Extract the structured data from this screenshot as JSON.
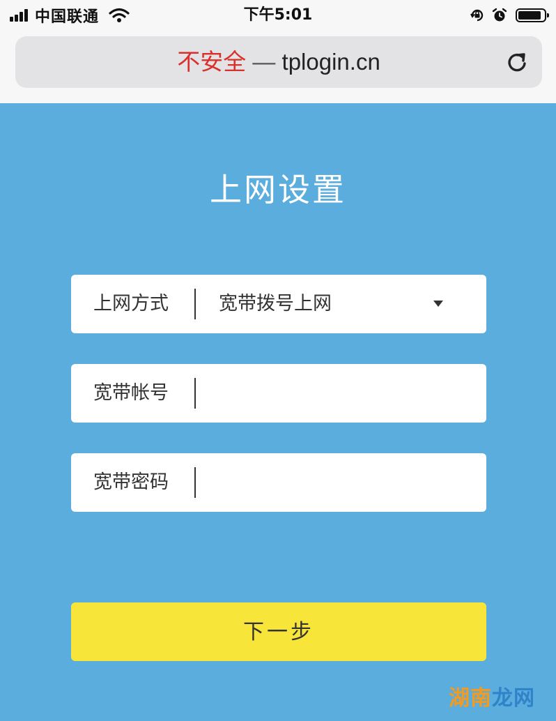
{
  "status_bar": {
    "carrier": "中国联通",
    "time": "下午5:01",
    "signal_bars": 4,
    "battery_level": 0.9,
    "icons": [
      "signal-icon",
      "wifi-icon",
      "orientation-lock-icon",
      "alarm-icon",
      "battery-icon"
    ]
  },
  "browser": {
    "security_warning": "不安全",
    "separator": "—",
    "domain": "tplogin.cn",
    "reload_icon": "reload-icon"
  },
  "page": {
    "title": "上网设置",
    "fields": [
      {
        "label": "上网方式",
        "value": "宽带拨号上网",
        "type": "select"
      },
      {
        "label": "宽带帐号",
        "value": "",
        "type": "text"
      },
      {
        "label": "宽带密码",
        "value": "",
        "type": "password"
      }
    ],
    "next_button": "下一步"
  },
  "watermark": {
    "part1": "湖南",
    "part2": "龙网"
  },
  "colors": {
    "page_background": "#5badde",
    "button_background": "#f8e53a",
    "warning_text": "#d9302b",
    "watermark_orange": "#f39a1f",
    "watermark_blue": "#2f83c9"
  }
}
